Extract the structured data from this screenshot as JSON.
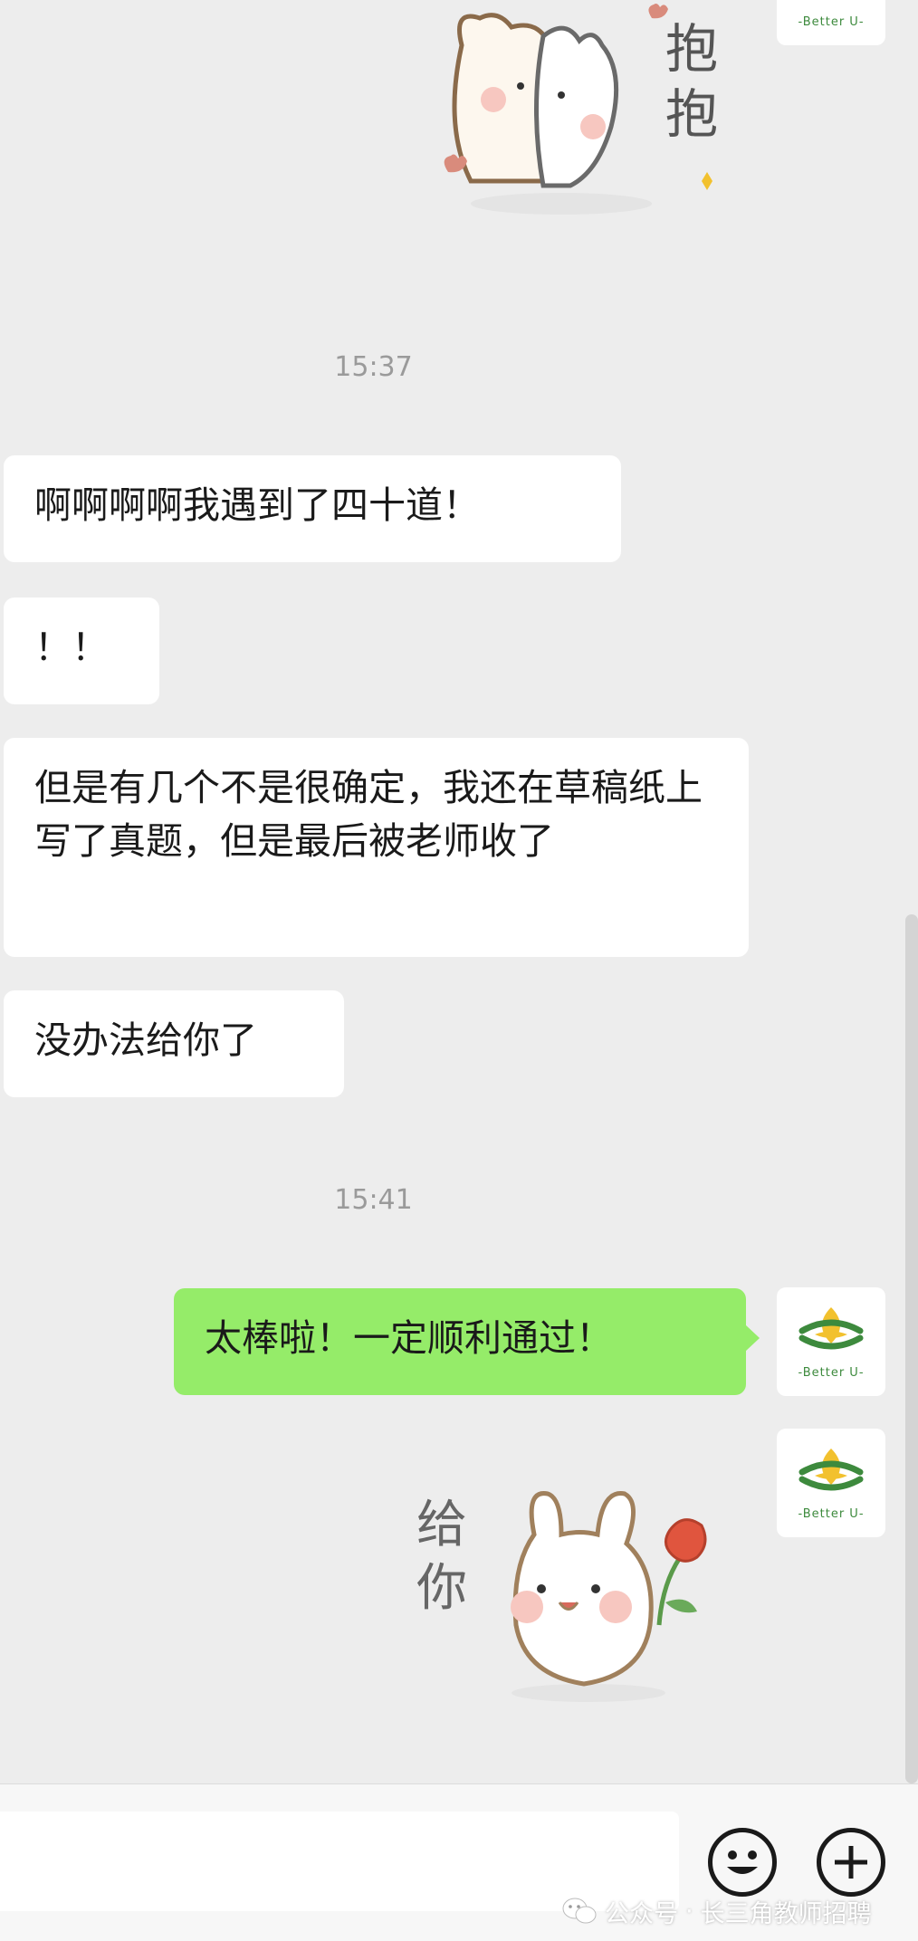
{
  "conversation": {
    "timestamps": [
      "15:37",
      "15:41"
    ],
    "messages": [
      {
        "sender": "contact",
        "text": "啊啊啊啊我遇到了四十道！"
      },
      {
        "sender": "contact",
        "text": "！！"
      },
      {
        "sender": "contact",
        "text": "但是有几个不是很确定，我还在草稿纸上写了真题，但是最后被老师收了"
      },
      {
        "sender": "contact",
        "text": "没办法给你了"
      },
      {
        "sender": "me",
        "text": "太棒啦！一定顺利通过！"
      }
    ],
    "stickers": [
      {
        "sender": "contact",
        "caption": "抱抱"
      },
      {
        "sender": "me",
        "caption": "给你"
      }
    ]
  },
  "my_avatar": {
    "text": "-Better U-"
  },
  "input_bar": {
    "emoji_icon": "smiley-face-icon",
    "more_icon": "plus-circle-icon"
  },
  "watermark": {
    "icon": "wechat-icon",
    "label": "公众号",
    "separator": "·",
    "account": "长三角教师招聘"
  },
  "colors": {
    "background": "#ededed",
    "my_bubble": "#95ec69",
    "contact_bubble": "#ffffff",
    "brand_green": "#3d8a3d",
    "brand_yellow": "#f2c12e"
  }
}
